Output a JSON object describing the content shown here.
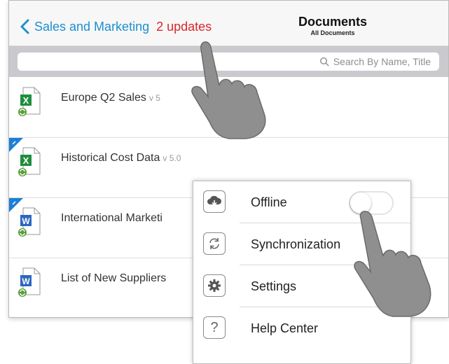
{
  "header": {
    "back_label": "Sales and Marketing",
    "updates_label": "2 updates",
    "title": "Documents",
    "subtitle": "All Documents"
  },
  "search": {
    "placeholder": "Search By Name, Title"
  },
  "documents": [
    {
      "name": "Europe Q2 Sales",
      "version": "v 5",
      "type": "excel",
      "new": false
    },
    {
      "name": "Historical Cost Data",
      "version": "v 5.0",
      "type": "excel",
      "new": true
    },
    {
      "name": "International Marketi",
      "version": "",
      "type": "word",
      "new": true
    },
    {
      "name": "List of New Suppliers",
      "version": "",
      "type": "word",
      "new": false
    }
  ],
  "menu": {
    "items": [
      {
        "label": "Offline",
        "icon": "cloud-download-icon",
        "toggle": "off"
      },
      {
        "label": "Synchronization",
        "icon": "sync-icon"
      },
      {
        "label": "Settings",
        "icon": "gear-icon"
      },
      {
        "label": "Help Center",
        "icon": "question-icon"
      }
    ]
  },
  "colors": {
    "accent": "#1d8fd0",
    "updates": "#d9262c",
    "excel": "#1e8e3e",
    "word": "#2b67c1",
    "sync_badge": "#5a9e3a",
    "new_ribbon": "#1d7fd8"
  }
}
